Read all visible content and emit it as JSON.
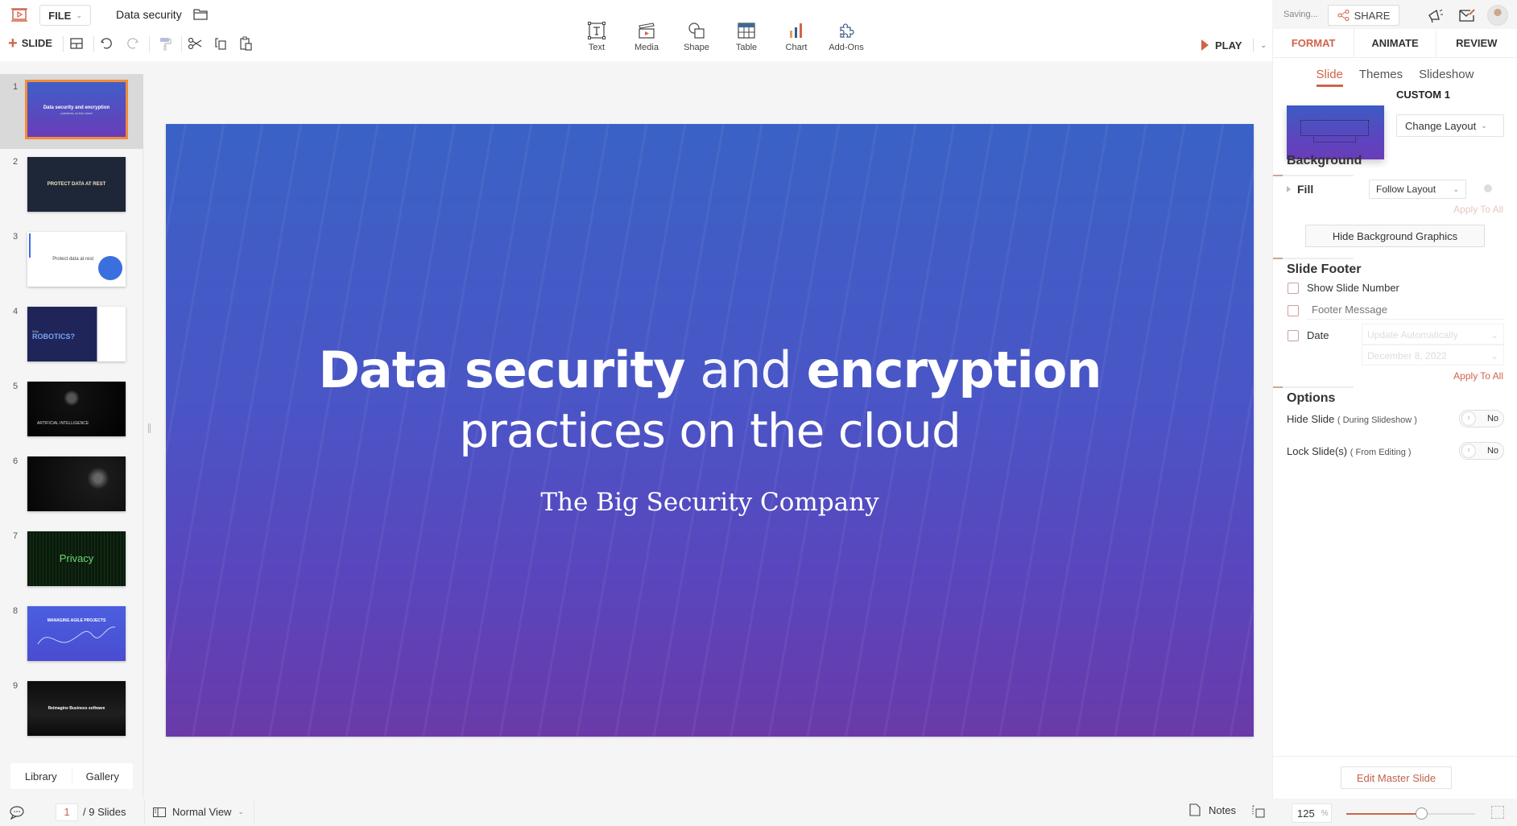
{
  "app": {
    "title": "Data security",
    "file_label": "FILE",
    "saving_status": "Saving...",
    "share_label": "SHARE",
    "accent_color": "#d0634b"
  },
  "toolbar": {
    "add_slide_label": "SLIDE",
    "insert_tools": [
      {
        "label": "Text",
        "icon": "text-box-icon"
      },
      {
        "label": "Media",
        "icon": "media-clapper-icon"
      },
      {
        "label": "Shape",
        "icon": "shape-icon"
      },
      {
        "label": "Table",
        "icon": "table-icon"
      },
      {
        "label": "Chart",
        "icon": "bar-chart-icon"
      },
      {
        "label": "Add-Ons",
        "icon": "puzzle-icon"
      }
    ],
    "play_label": "PLAY"
  },
  "right_panel": {
    "tabs": [
      {
        "label": "FORMAT",
        "active": true
      },
      {
        "label": "ANIMATE",
        "active": false
      },
      {
        "label": "REVIEW",
        "active": false
      }
    ],
    "subtabs": [
      {
        "label": "Slide",
        "active": true
      },
      {
        "label": "Themes",
        "active": false
      },
      {
        "label": "Slideshow",
        "active": false
      }
    ],
    "layout_name": "CUSTOM 1",
    "change_layout_label": "Change Layout",
    "background": {
      "title": "Background",
      "fill_label": "Fill",
      "fill_value": "Follow Layout",
      "apply_all_label": "Apply To All",
      "hide_graphics_label": "Hide Background Graphics"
    },
    "slide_footer": {
      "title": "Slide Footer",
      "show_slide_number_label": "Show Slide Number",
      "show_slide_number_checked": false,
      "footer_message_placeholder": "Footer Message",
      "footer_message_checked": false,
      "date_label": "Date",
      "date_checked": false,
      "date_mode": "Update Automatically",
      "date_value": "December 8, 2022",
      "apply_all_label": "Apply To All"
    },
    "options": {
      "title": "Options",
      "hide_slide_label": "Hide Slide",
      "hide_slide_sub": "( During Slideshow )",
      "hide_slide_value": "No",
      "lock_slide_label": "Lock Slide(s)",
      "lock_slide_sub": "( From Editing )",
      "lock_slide_value": "No"
    },
    "edit_master_label": "Edit Master Slide"
  },
  "slides": [
    {
      "num": "1",
      "title": "Data security and encryption",
      "subtitle": "practices on the cloud",
      "active": true
    },
    {
      "num": "2",
      "title": "PROTECT DATA AT REST",
      "subtitle": ""
    },
    {
      "num": "3",
      "title": "Protect data at rest",
      "subtitle": ""
    },
    {
      "num": "4",
      "title": "ROBOTICS?",
      "subtitle": "Why"
    },
    {
      "num": "5",
      "title": "ARTIFICIAL INTELLIGENCE",
      "subtitle": ""
    },
    {
      "num": "6",
      "title": "",
      "subtitle": ""
    },
    {
      "num": "7",
      "title": "Privacy",
      "subtitle": ""
    },
    {
      "num": "8",
      "title": "MANAGING AGILE PROJECTS",
      "subtitle": ""
    },
    {
      "num": "9",
      "title": "Reimagine Business software",
      "subtitle": ""
    }
  ],
  "left_panel": {
    "library_label": "Library",
    "gallery_label": "Gallery"
  },
  "current_slide": {
    "title_bold_1": "Data security",
    "title_light": " and ",
    "title_bold_2": "encryption",
    "subtitle": "practices on the cloud",
    "company": "The Big Security Company"
  },
  "statusbar": {
    "current_page": "1",
    "total_label": "/ 9 Slides",
    "view_label": "Normal View",
    "notes_label": "Notes",
    "zoom_value": "125",
    "zoom_unit": "%",
    "zoom_fraction": 0.58
  }
}
